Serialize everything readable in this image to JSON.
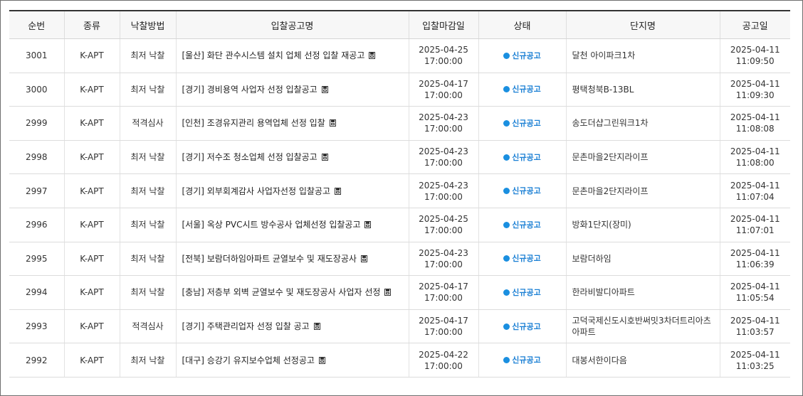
{
  "headers": {
    "no": "순번",
    "type": "종류",
    "method": "낙찰방법",
    "title": "입찰공고명",
    "deadline": "입찰마감일",
    "status": "상태",
    "complex": "단지명",
    "notice_date": "공고일"
  },
  "colors": {
    "status_blue": "#1a7fd4",
    "header_border": "#333333"
  },
  "icons": {
    "attachment": "floppy-disk-icon",
    "status": "status-dot-icon"
  },
  "rows": [
    {
      "no": "3001",
      "type": "K-APT",
      "method": "최저 낙찰",
      "title": "[울산] 화단 관수시스템 설치 업체 선정 입찰 재공고",
      "deadline_date": "2025-04-25",
      "deadline_time": "17:00:00",
      "status": "신규공고",
      "complex": "달천 아이파크1차",
      "notice_date": "2025-04-11",
      "notice_time": "11:09:50"
    },
    {
      "no": "3000",
      "type": "K-APT",
      "method": "최저 낙찰",
      "title": "[경기] 경비용역 사업자 선정 입찰공고",
      "deadline_date": "2025-04-17",
      "deadline_time": "17:00:00",
      "status": "신규공고",
      "complex": "평택청북B-13BL",
      "notice_date": "2025-04-11",
      "notice_time": "11:09:30"
    },
    {
      "no": "2999",
      "type": "K-APT",
      "method": "적격심사",
      "title": "[인천] 조경유지관리 용역업체 선정 입찰",
      "deadline_date": "2025-04-23",
      "deadline_time": "17:00:00",
      "status": "신규공고",
      "complex": "송도더샵그린워크1차",
      "notice_date": "2025-04-11",
      "notice_time": "11:08:08"
    },
    {
      "no": "2998",
      "type": "K-APT",
      "method": "최저 낙찰",
      "title": "[경기] 저수조 청소업체 선정 입찰공고",
      "deadline_date": "2025-04-23",
      "deadline_time": "17:00:00",
      "status": "신규공고",
      "complex": "문촌마을2단지라이프",
      "notice_date": "2025-04-11",
      "notice_time": "11:08:00"
    },
    {
      "no": "2997",
      "type": "K-APT",
      "method": "최저 낙찰",
      "title": "[경기] 외부회계감사 사업자선정 입찰공고",
      "deadline_date": "2025-04-23",
      "deadline_time": "17:00:00",
      "status": "신규공고",
      "complex": "문촌마을2단지라이프",
      "notice_date": "2025-04-11",
      "notice_time": "11:07:04"
    },
    {
      "no": "2996",
      "type": "K-APT",
      "method": "최저 낙찰",
      "title": "[서울] 옥상 PVC시트 방수공사 업체선정 입찰공고",
      "deadline_date": "2025-04-25",
      "deadline_time": "17:00:00",
      "status": "신규공고",
      "complex": "방화1단지(장미)",
      "notice_date": "2025-04-11",
      "notice_time": "11:07:01"
    },
    {
      "no": "2995",
      "type": "K-APT",
      "method": "최저 낙찰",
      "title": "[전북] 보람더하임아파트 균열보수 및 재도장공사",
      "deadline_date": "2025-04-23",
      "deadline_time": "17:00:00",
      "status": "신규공고",
      "complex": "보람더하임",
      "notice_date": "2025-04-11",
      "notice_time": "11:06:39"
    },
    {
      "no": "2994",
      "type": "K-APT",
      "method": "최저 낙찰",
      "title": "[충남] 저층부 외벽 균열보수 및 재도장공사 사업자 선정",
      "deadline_date": "2025-04-17",
      "deadline_time": "17:00:00",
      "status": "신규공고",
      "complex": "한라비발디아파트",
      "notice_date": "2025-04-11",
      "notice_time": "11:05:54"
    },
    {
      "no": "2993",
      "type": "K-APT",
      "method": "적격심사",
      "title": "[경기] 주택관리업자 선정 입찰 공고",
      "deadline_date": "2025-04-17",
      "deadline_time": "17:00:00",
      "status": "신규공고",
      "complex": "고덕국제신도시호반써밋3차더트리아츠아파트",
      "notice_date": "2025-04-11",
      "notice_time": "11:03:57"
    },
    {
      "no": "2992",
      "type": "K-APT",
      "method": "최저 낙찰",
      "title": "[대구] 승강기 유지보수업체 선정공고",
      "deadline_date": "2025-04-22",
      "deadline_time": "17:00:00",
      "status": "신규공고",
      "complex": "대봉서한이다음",
      "notice_date": "2025-04-11",
      "notice_time": "11:03:25"
    }
  ]
}
